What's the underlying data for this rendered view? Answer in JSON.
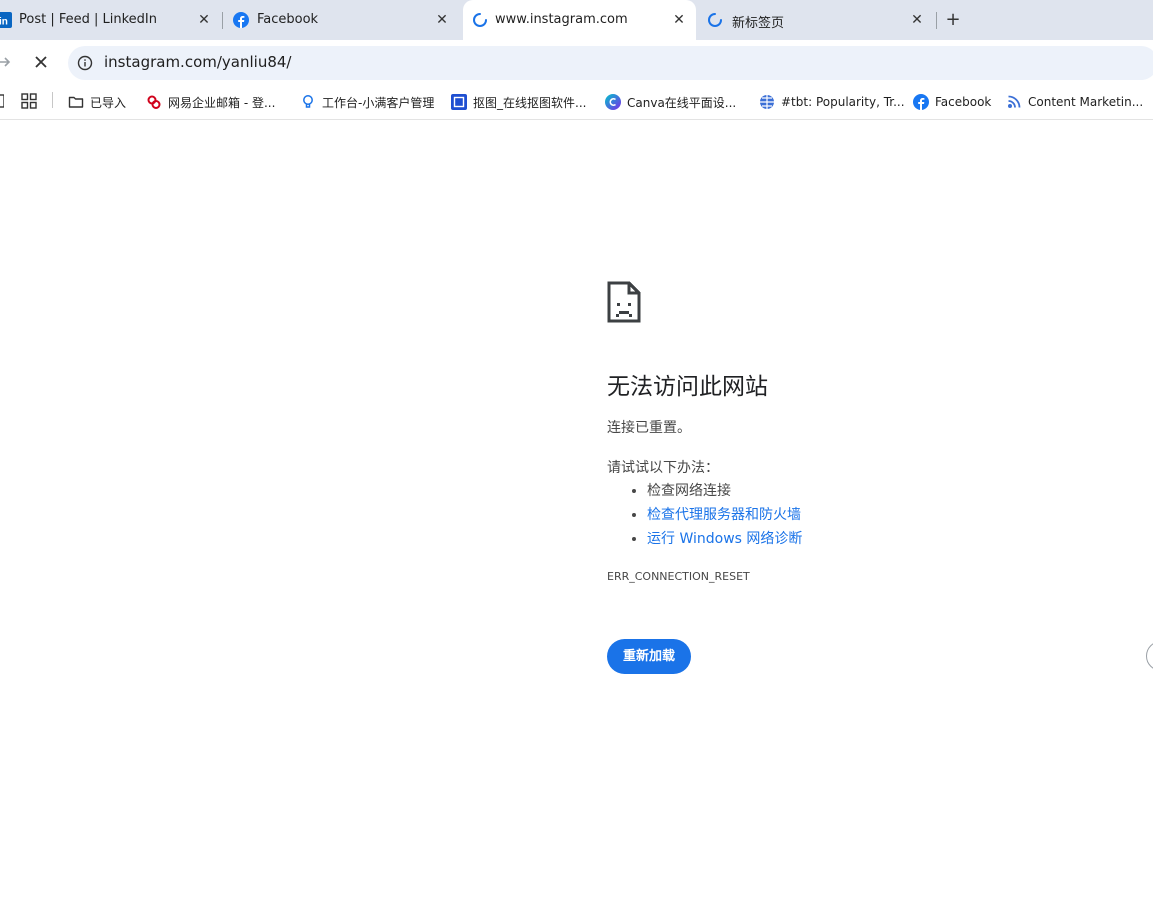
{
  "browser": {
    "tabs": [
      {
        "title": "Post | Feed | LinkedIn",
        "icon": "linkedin-icon",
        "active": false
      },
      {
        "title": "Facebook",
        "icon": "facebook-icon",
        "active": false
      },
      {
        "title": "www.instagram.com",
        "icon": "loading-spinner-icon",
        "active": true
      },
      {
        "title": "新标签页",
        "icon": "loading-spinner-icon",
        "active": false
      }
    ],
    "close_glyph": "✕",
    "new_tab_glyph": "+",
    "url": "instagram.com/yanliu84/",
    "accent_color": "#1a73e8",
    "tabstrip_color": "#dfe4ee",
    "omnibox_color": "#edf2fa"
  },
  "bookmarks": {
    "items": [
      {
        "label": "已导入",
        "icon": "folder-icon"
      },
      {
        "label": "网易企业邮箱 - 登...",
        "icon": "netease-mail-icon"
      },
      {
        "label": "工作台-小满客户管理",
        "icon": "lightbulb-icon"
      },
      {
        "label": "抠图_在线抠图软件...",
        "icon": "cutout-icon"
      },
      {
        "label": "Canva在线平面设...",
        "icon": "canva-icon"
      },
      {
        "label": "#tbt: Popularity, Tr...",
        "icon": "globe-icon"
      },
      {
        "label": "Facebook",
        "icon": "facebook-icon"
      },
      {
        "label": "Content Marketin...",
        "icon": "rss-icon"
      }
    ]
  },
  "error_page": {
    "title": "无法访问此网站",
    "description": "连接已重置。",
    "try_heading": "请试试以下办法：",
    "suggestions": [
      {
        "text": "检查网络连接",
        "link": false
      },
      {
        "text": "检查代理服务器和防火墙",
        "link": true
      },
      {
        "text": "运行 Windows 网络诊断",
        "link": true
      }
    ],
    "error_code": "ERR_CONNECTION_RESET",
    "reload_label": "重新加载",
    "icon": "sad-document-icon"
  }
}
